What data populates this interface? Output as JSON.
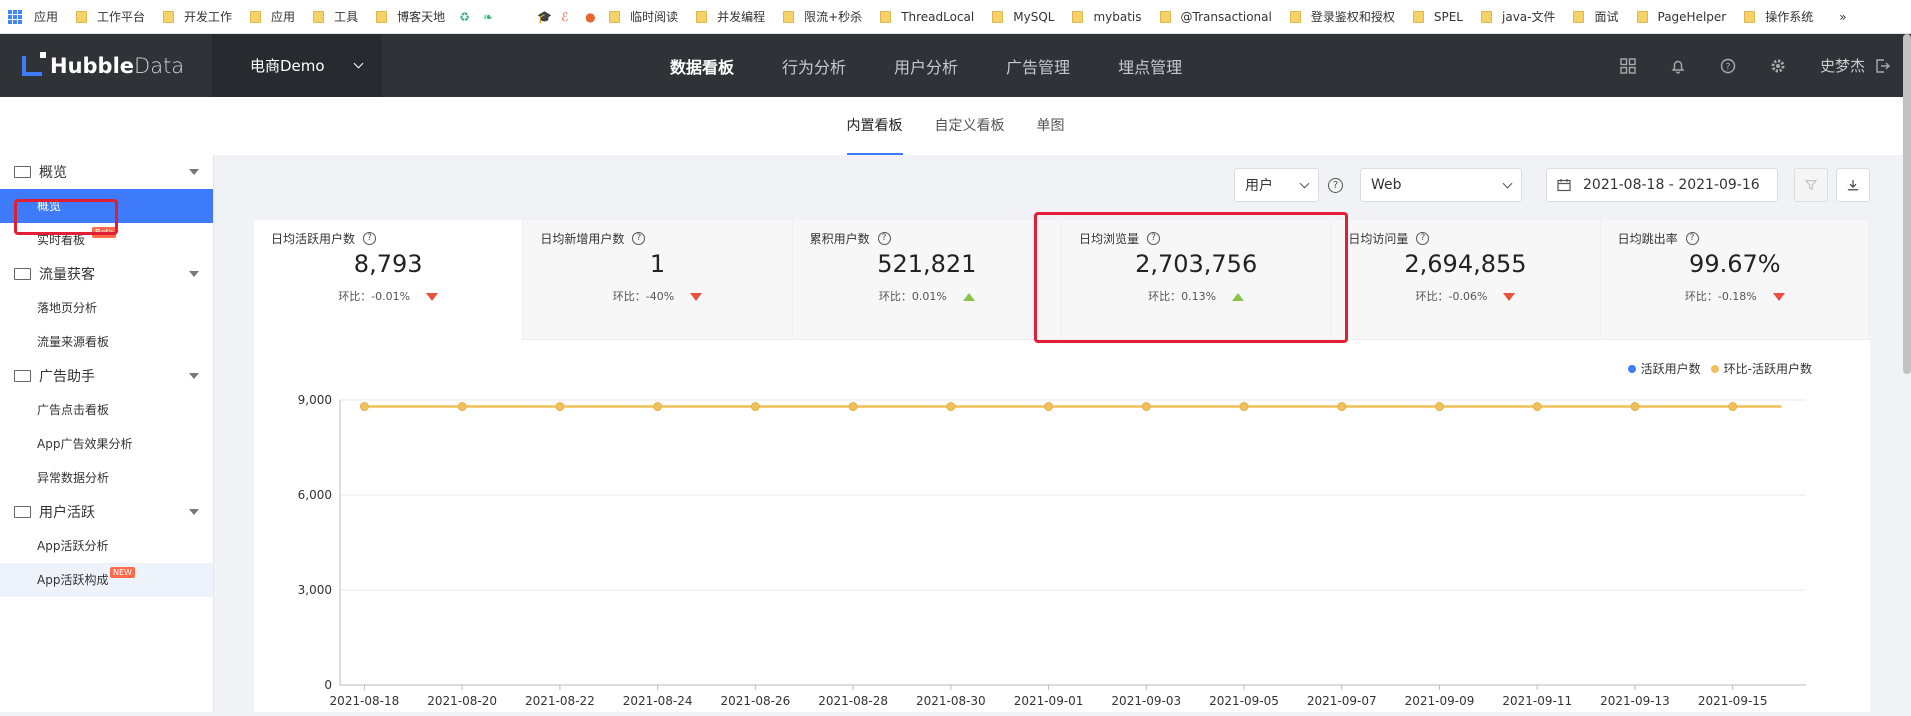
{
  "bookmarks": {
    "apps_label": "应用",
    "items": [
      "工作平台",
      "开发工作",
      "应用",
      "工具",
      "博客天地"
    ],
    "items2": [
      "临时阅读",
      "并发编程",
      "限流+秒杀",
      "ThreadLocal",
      "MySQL",
      "mybatis",
      "@Transactional",
      "登录鉴权和授权",
      "SPEL",
      "java-文件",
      "面试",
      "PageHelper",
      "操作系统"
    ],
    "more": "»"
  },
  "nav": {
    "logo_bold": "Hubble",
    "logo_light": "Data",
    "project": "电商Demo",
    "menu": [
      "数据看板",
      "行为分析",
      "用户分析",
      "广告管理",
      "埋点管理"
    ],
    "active_index": 0,
    "user": "史梦杰"
  },
  "subtabs": {
    "items": [
      "内置看板",
      "自定义看板",
      "单图"
    ],
    "active_index": 0
  },
  "sidebar": {
    "groups": [
      {
        "label": "概览",
        "items": [
          {
            "label": "概览",
            "selected": true
          },
          {
            "label": "实时看板",
            "badge": "Beta"
          }
        ]
      },
      {
        "label": "流量获客",
        "items": [
          {
            "label": "落地页分析"
          },
          {
            "label": "流量来源看板"
          }
        ]
      },
      {
        "label": "广告助手",
        "items": [
          {
            "label": "广告点击看板"
          },
          {
            "label": "App广告效果分析"
          },
          {
            "label": "异常数据分析"
          }
        ]
      },
      {
        "label": "用户活跃",
        "items": [
          {
            "label": "App活跃分析"
          },
          {
            "label": "App活跃构成",
            "badge": "NEW",
            "highlight": true
          }
        ]
      }
    ]
  },
  "filters": {
    "subject": "用户",
    "platform": "Web",
    "date_range": "2021-08-18 - 2021-09-16"
  },
  "metrics": [
    {
      "label": "日均活跃用户数",
      "value": "8,793",
      "change": "环比：-0.01%",
      "trend": "down"
    },
    {
      "label": "日均新增用户数",
      "value": "1",
      "change": "环比：-40%",
      "trend": "down"
    },
    {
      "label": "累积用户数",
      "value": "521,821",
      "change": "环比：0.01%",
      "trend": "up"
    },
    {
      "label": "日均浏览量",
      "value": "2,703,756",
      "change": "环比：0.13%",
      "trend": "up"
    },
    {
      "label": "日均访问量",
      "value": "2,694,855",
      "change": "环比：-0.06%",
      "trend": "down"
    },
    {
      "label": "日均跳出率",
      "value": "99.67%",
      "change": "环比：-0.18%",
      "trend": "down"
    }
  ],
  "colors": {
    "accent": "#3e7bfa",
    "nav_bg": "#2f3338",
    "highlight_box": "#e01f35",
    "series_active": "#3e7bfa",
    "series_change": "#f0c05a",
    "down": "#e9513d",
    "up": "#8bc34a"
  },
  "chart_data": {
    "type": "line",
    "legend": [
      "活跃用户数",
      "环比-活跃用户数"
    ],
    "legend_position": "top-right",
    "y_ticks": [
      "9,000",
      "6,000",
      "3,000",
      "0"
    ],
    "ylim": [
      0,
      9000
    ],
    "x_ticks": [
      "2021-08-18",
      "2021-08-20",
      "2021-08-22",
      "2021-08-24",
      "2021-08-26",
      "2021-08-28",
      "2021-08-30",
      "2021-09-01",
      "2021-09-03",
      "2021-09-05",
      "2021-09-07",
      "2021-09-09",
      "2021-09-11",
      "2021-09-13",
      "2021-09-15"
    ],
    "x": [
      "2021-08-18",
      "2021-08-19",
      "2021-08-20",
      "2021-08-21",
      "2021-08-22",
      "2021-08-23",
      "2021-08-24",
      "2021-08-25",
      "2021-08-26",
      "2021-08-27",
      "2021-08-28",
      "2021-08-29",
      "2021-08-30",
      "2021-08-31",
      "2021-09-01",
      "2021-09-02",
      "2021-09-03",
      "2021-09-04",
      "2021-09-05",
      "2021-09-06",
      "2021-09-07",
      "2021-09-08",
      "2021-09-09",
      "2021-09-10",
      "2021-09-11",
      "2021-09-12",
      "2021-09-13",
      "2021-09-14",
      "2021-09-15",
      "2021-09-16"
    ],
    "series": [
      {
        "name": "环比-活跃用户数",
        "values": [
          8793,
          8793,
          8793,
          8793,
          8793,
          8793,
          8793,
          8793,
          8793,
          8793,
          8793,
          8793,
          8793,
          8793,
          8793,
          8793,
          8793,
          8793,
          8793,
          8793,
          8793,
          8793,
          8793,
          8793,
          8793,
          8793,
          8793,
          8793,
          8793,
          8793
        ],
        "marker_every": 2
      }
    ],
    "grid": true
  }
}
